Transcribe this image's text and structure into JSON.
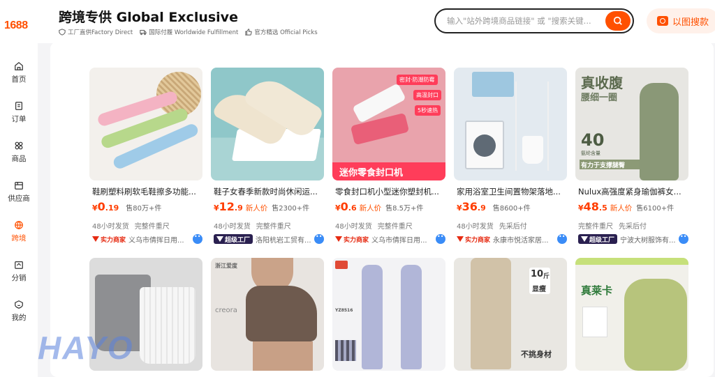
{
  "app": {
    "logo": "1688"
  },
  "sidebar": {
    "items": [
      {
        "label": "首页",
        "icon": "home-icon"
      },
      {
        "label": "订单",
        "icon": "order-icon"
      },
      {
        "label": "商品",
        "icon": "grid-icon"
      },
      {
        "label": "供应商",
        "icon": "store-icon"
      },
      {
        "label": "跨境",
        "icon": "globe-icon",
        "active": true
      },
      {
        "label": "分销",
        "icon": "share-icon"
      },
      {
        "label": "我的",
        "icon": "user-icon"
      }
    ]
  },
  "header": {
    "title": "跨境专供 Global Exclusive",
    "tags": [
      {
        "icon": "shield-icon",
        "label": "工厂直供Factory Direct"
      },
      {
        "icon": "truck-icon",
        "label": "国际付履 Worldwide Fulfillment"
      },
      {
        "icon": "thumbs-up-icon",
        "label": "官方精选 Official Picks"
      }
    ],
    "search": {
      "placeholder": "输入\"站外跨境商品链接\" 或 \"搜索关键..."
    },
    "image_search_label": "以图搜款"
  },
  "products": [
    {
      "name": "鞋刷塑料刷软毛鞋擦多功能...",
      "currency": "¥",
      "price_int": "0",
      "price_dec": ".19",
      "badge": "",
      "sold": "售80万+件",
      "tags": [
        "48小时发货",
        "完整件重尺"
      ],
      "shop_type": "实力商家",
      "shop_dark": false,
      "shop": "义乌市倩挥日用..."
    },
    {
      "name": "鞋子女春季新款时尚休闲运...",
      "currency": "¥",
      "price_int": "12",
      "price_dec": ".9",
      "badge": "新人价",
      "sold": "售2300+件",
      "tags": [
        "48小时发货",
        "完整件重尺"
      ],
      "shop_type": "超级工厂",
      "shop_dark": true,
      "shop": "洛阳杭岩工贸有..."
    },
    {
      "name": "零食封口机小型迷你塑封机...",
      "currency": "¥",
      "price_int": "0",
      "price_dec": ".6",
      "badge": "新人价",
      "sold": "售8.5万+件",
      "tags": [
        "48小时发货",
        "完整件重尺"
      ],
      "shop_type": "实力商家",
      "shop_dark": false,
      "shop": "义乌市倩挥日用..."
    },
    {
      "name": "家用浴室卫生间置物架落地...",
      "currency": "¥",
      "price_int": "36",
      "price_dec": ".9",
      "badge": "",
      "sold": "售8600+件",
      "tags": [
        "48小时发货",
        "先采后付"
      ],
      "shop_type": "实力商家",
      "shop_dark": false,
      "shop": "永康市悦活家居..."
    },
    {
      "name": "Nulux高强度紧身瑜伽裤女...",
      "currency": "¥",
      "price_int": "48",
      "price_dec": ".5",
      "badge": "新人价",
      "sold": "售6100+件",
      "tags": [
        "完整件重尺",
        "先采后付"
      ],
      "shop_type": "超级工厂",
      "shop_dark": true,
      "shop": "宁波大树服饰有..."
    }
  ],
  "image_texts": {
    "sealer": [
      "密封·防潮防霉",
      "高温封口",
      "5秒速热",
      "迷你零食封口机"
    ],
    "leggings_top": "真收腹",
    "leggings_sub": "腰细一圈",
    "leggings_num": "40",
    "leggings_num_sub": "氨纶含量",
    "leggings_slogan": "有力于支撑腿臀",
    "bra_brand": "浙江爱度",
    "bra_logo": "creora",
    "set_code": "YZ8516",
    "pants_num": "10",
    "pants_unit": "斤",
    "pants_text": "显瘦",
    "pants_bottom": "不挑身材",
    "shorts_title": "真莱卡"
  },
  "watermark": "HAYO",
  "colors": {
    "accent": "#ff5000",
    "price": "#ff3d00"
  }
}
